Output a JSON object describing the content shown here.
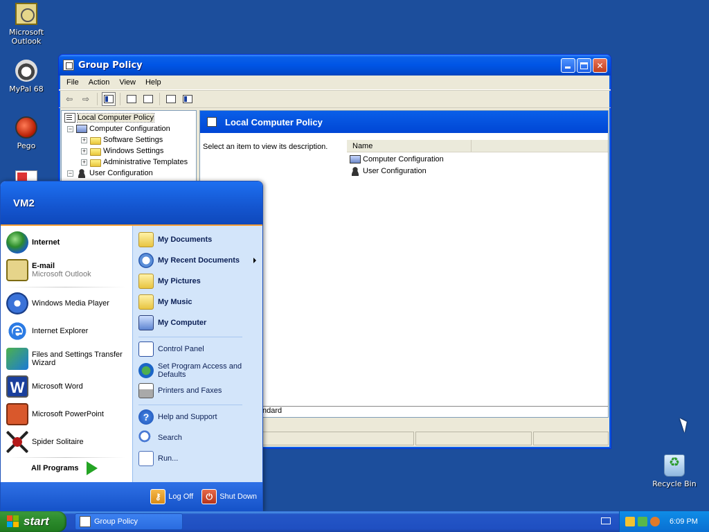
{
  "desktop": {
    "icons": [
      {
        "label": "Microsoft Outlook",
        "icon": "outlook-icon"
      },
      {
        "label": "MyPal 68",
        "icon": "mypal-icon"
      },
      {
        "label": "Pego",
        "icon": "pego-icon"
      },
      {
        "label": "Recycle Bin",
        "icon": "recycle-bin-icon"
      }
    ]
  },
  "window": {
    "title": "Group Policy",
    "menu": [
      "File",
      "Action",
      "View",
      "Help"
    ],
    "tree": {
      "root": "Local Computer Policy",
      "computer_config": "Computer Configuration",
      "software_settings": "Software Settings",
      "windows_settings": "Windows Settings",
      "admin_templates": "Administrative Templates",
      "user_config": "User Configuration"
    },
    "right_pane": {
      "header": "Local Computer Policy",
      "description": "Select an item to view its description.",
      "column_name": "Name",
      "items": [
        "Computer Configuration",
        "User Configuration"
      ],
      "tab_standard": "ndard"
    }
  },
  "start_menu": {
    "user": "VM2",
    "pinned": [
      {
        "title": "Internet",
        "subtitle": ""
      },
      {
        "title": "E-mail",
        "subtitle": "Microsoft Outlook"
      }
    ],
    "recent": [
      "Windows Media Player",
      "Internet Explorer",
      "Files and Settings Transfer Wizard",
      "Microsoft Word",
      "Microsoft PowerPoint",
      "Spider Solitaire"
    ],
    "all_programs": "All Programs",
    "places": {
      "my_documents": "My Documents",
      "my_recent_documents": "My Recent Documents",
      "my_pictures": "My Pictures",
      "my_music": "My Music",
      "my_computer": "My Computer",
      "control_panel": "Control Panel",
      "set_program_access": "Set Program Access and Defaults",
      "printers_faxes": "Printers and Faxes",
      "help_support": "Help and Support",
      "search": "Search",
      "run": "Run..."
    },
    "log_off": "Log Off",
    "shut_down": "Shut Down"
  },
  "taskbar": {
    "start": "start",
    "task_button": "Group Policy",
    "clock": "6:09 PM"
  }
}
